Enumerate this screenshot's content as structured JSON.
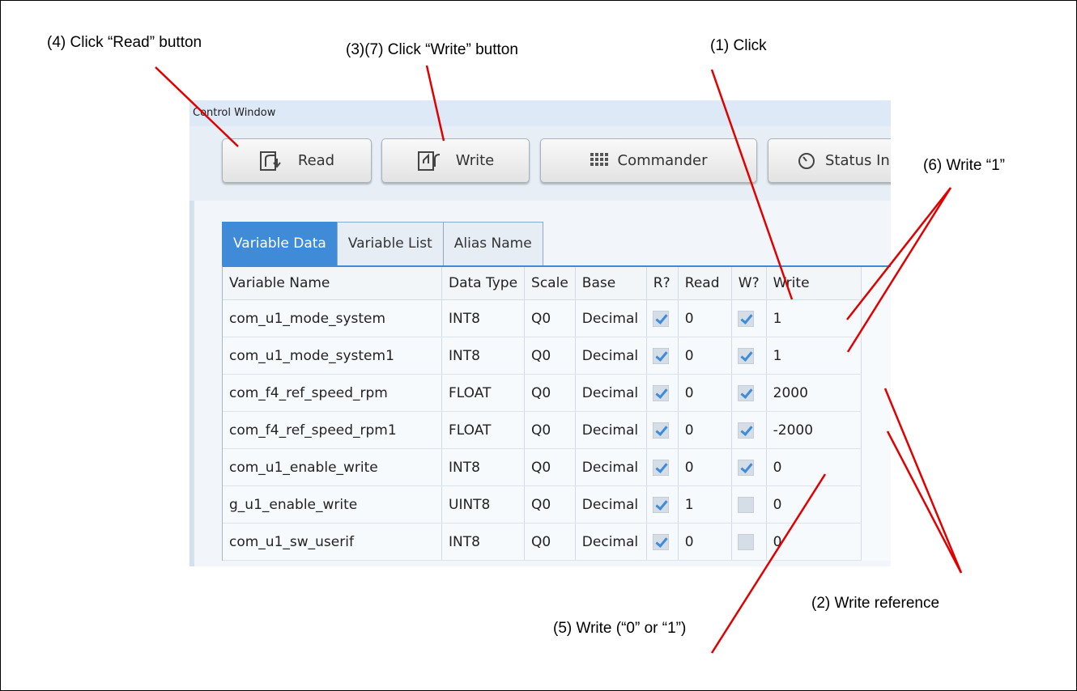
{
  "annotations": {
    "read_button": "(4) Click “Read” button",
    "write_button": "(3)(7) Click “Write” button",
    "click": "(1) Click",
    "write_one": "(6) Write “1”",
    "write_reference": "(2) Write reference",
    "write_zero_or_one": "(5) Write (“0” or “1”)"
  },
  "window": {
    "title": "Control Window",
    "toolbar": {
      "read_label": "Read",
      "write_label": "Write",
      "commander_label": "Commander",
      "status_label": "Status In"
    },
    "tabs": [
      "Variable Data",
      "Variable List",
      "Alias Name"
    ],
    "active_tab": 0,
    "table": {
      "headers": [
        "Variable Name",
        "Data Type",
        "Scale",
        "Base",
        "R?",
        "Read",
        "W?",
        "Write"
      ],
      "rows": [
        {
          "name": "com_u1_mode_system",
          "type": "INT8",
          "scale": "Q0",
          "base": "Decimal",
          "r": true,
          "read": "0",
          "w": true,
          "write": "1"
        },
        {
          "name": "com_u1_mode_system1",
          "type": "INT8",
          "scale": "Q0",
          "base": "Decimal",
          "r": true,
          "read": "0",
          "w": true,
          "write": "1"
        },
        {
          "name": "com_f4_ref_speed_rpm",
          "type": "FLOAT",
          "scale": "Q0",
          "base": "Decimal",
          "r": true,
          "read": "0",
          "w": true,
          "write": "2000"
        },
        {
          "name": "com_f4_ref_speed_rpm1",
          "type": "FLOAT",
          "scale": "Q0",
          "base": "Decimal",
          "r": true,
          "read": "0",
          "w": true,
          "write": "-2000"
        },
        {
          "name": "com_u1_enable_write",
          "type": "INT8",
          "scale": "Q0",
          "base": "Decimal",
          "r": true,
          "read": "0",
          "w": true,
          "write": "0"
        },
        {
          "name": "g_u1_enable_write",
          "type": "UINT8",
          "scale": "Q0",
          "base": "Decimal",
          "r": true,
          "read": "1",
          "w": false,
          "write": "0"
        },
        {
          "name": "com_u1_sw_userif",
          "type": "INT8",
          "scale": "Q0",
          "base": "Decimal",
          "r": true,
          "read": "0",
          "w": false,
          "write": "0"
        }
      ]
    }
  },
  "colors": {
    "accent": "#3f8bd8",
    "annotation_line": "#e00000"
  }
}
